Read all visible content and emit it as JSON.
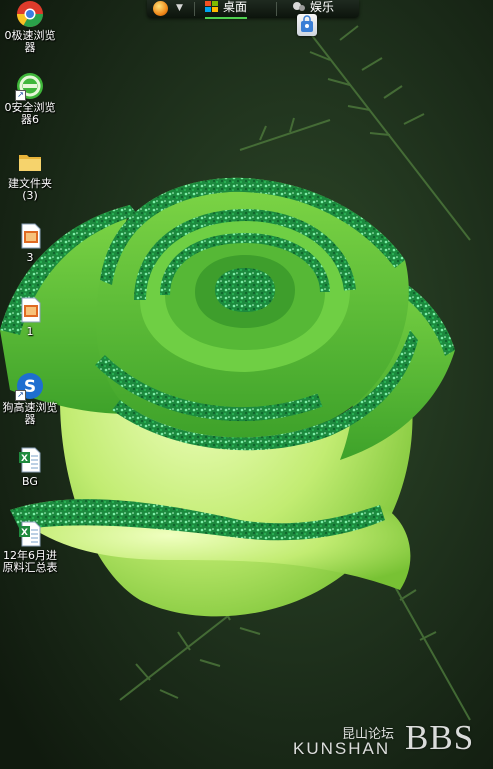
{
  "toolbar": {
    "tabs": [
      {
        "label": "桌面",
        "active": true
      },
      {
        "label": "娱乐",
        "active": false
      }
    ]
  },
  "desktop_icons": [
    {
      "name": "browser-speed",
      "label": "0极速浏览\n器",
      "icon": "chrome-icon"
    },
    {
      "name": "browser-safe",
      "label": "0安全浏览\n器6",
      "icon": "360-browser-icon"
    },
    {
      "name": "new-folder",
      "label": "建文件夹\n(3)",
      "icon": "folder-icon"
    },
    {
      "name": "file-3",
      "label": "3",
      "icon": "presentation-file-icon"
    },
    {
      "name": "file-1",
      "label": "1",
      "icon": "presentation-file-icon"
    },
    {
      "name": "browser-sogou",
      "label": "狗高速浏览\n器",
      "icon": "sogou-browser-icon"
    },
    {
      "name": "file-bg",
      "label": "BG",
      "icon": "excel-file-icon"
    },
    {
      "name": "file-summary",
      "label": "12年6月进\n原料汇总表",
      "icon": "excel-file-icon"
    }
  ],
  "watermark": {
    "cn": "昆山论坛",
    "en": "KUNSHAN",
    "bbs": "BBS"
  },
  "colors": {
    "rose_light": "#c8f07a",
    "rose_mid": "#4fc83a",
    "glitter": "#0f7a3a",
    "background": "#1b2a18"
  }
}
